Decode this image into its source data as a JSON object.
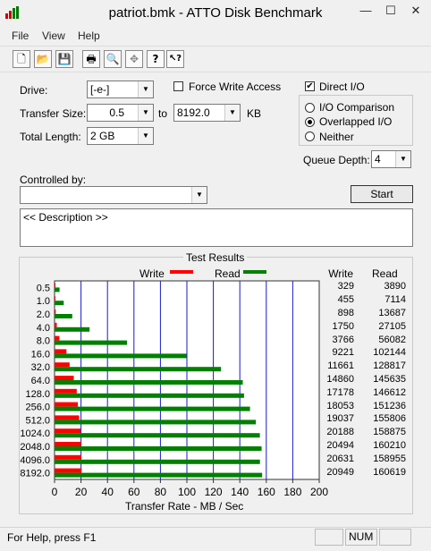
{
  "window": {
    "title": "patriot.bmk - ATTO Disk Benchmark",
    "minimize": "—",
    "maximize": "☐",
    "close": "✕"
  },
  "menu": [
    "File",
    "View",
    "Help"
  ],
  "toolbar": {
    "buttons": [
      {
        "name": "new-file-icon",
        "glyph": "🗋"
      },
      {
        "name": "open-folder-icon",
        "glyph": "📂"
      },
      {
        "name": "save-icon",
        "glyph": "💾"
      },
      {
        "name": "print-icon",
        "glyph": "🖶"
      },
      {
        "name": "print-preview-icon",
        "glyph": "🔍"
      },
      {
        "name": "move-icon",
        "glyph": "✥"
      },
      {
        "name": "help-icon",
        "glyph": "?"
      },
      {
        "name": "context-help-icon",
        "glyph": "↖?"
      }
    ]
  },
  "form": {
    "drive_label": "Drive:",
    "drive_value": "[-e-]",
    "force_write_label": "Force Write Access",
    "direct_io_label": "Direct I/O",
    "direct_io_checked": "✔",
    "transfer_size_label": "Transfer Size:",
    "transfer_from": "0.5",
    "to_label": "to",
    "transfer_to": "8192.0",
    "kb_label": "KB",
    "total_length_label": "Total Length:",
    "total_length_value": "2 GB",
    "io_comparison_label": "I/O Comparison",
    "overlapped_io_label": "Overlapped I/O",
    "neither_label": "Neither",
    "queue_depth_label": "Queue Depth:",
    "queue_depth_value": "4",
    "controlled_by_label": "Controlled by:",
    "controlled_by_value": "",
    "start_label": "Start",
    "description": "<< Description >>"
  },
  "chart_data": {
    "type": "bar",
    "title": "Test Results",
    "xlabel": "Transfer Rate - MB / Sec",
    "xlim": [
      0,
      200
    ],
    "xticks": [
      "0",
      "20",
      "40",
      "60",
      "80",
      "100",
      "120",
      "140",
      "160",
      "180",
      "200"
    ],
    "legend": [
      "Write",
      "Read"
    ],
    "column_headers": [
      "Write",
      "Read"
    ],
    "colors": {
      "write": "#ff0000",
      "read": "#008000",
      "grid": "#1a1acc"
    },
    "categories": [
      "0.5",
      "1.0",
      "2.0",
      "4.0",
      "8.0",
      "16.0",
      "32.0",
      "64.0",
      "128.0",
      "256.0",
      "512.0",
      "1024.0",
      "2048.0",
      "4096.0",
      "8192.0"
    ],
    "series": [
      {
        "name": "Write",
        "values_kbps": [
          329,
          455,
          898,
          1750,
          3766,
          9221,
          11661,
          14860,
          17178,
          18053,
          19037,
          20188,
          20494,
          20631,
          20949
        ]
      },
      {
        "name": "Read",
        "values_kbps": [
          3890,
          7114,
          13687,
          27105,
          56082,
          102144,
          128817,
          145635,
          146612,
          151236,
          155806,
          158875,
          160210,
          158955,
          160619
        ]
      }
    ]
  },
  "status": {
    "help": "For Help, press F1",
    "num": "NUM"
  }
}
